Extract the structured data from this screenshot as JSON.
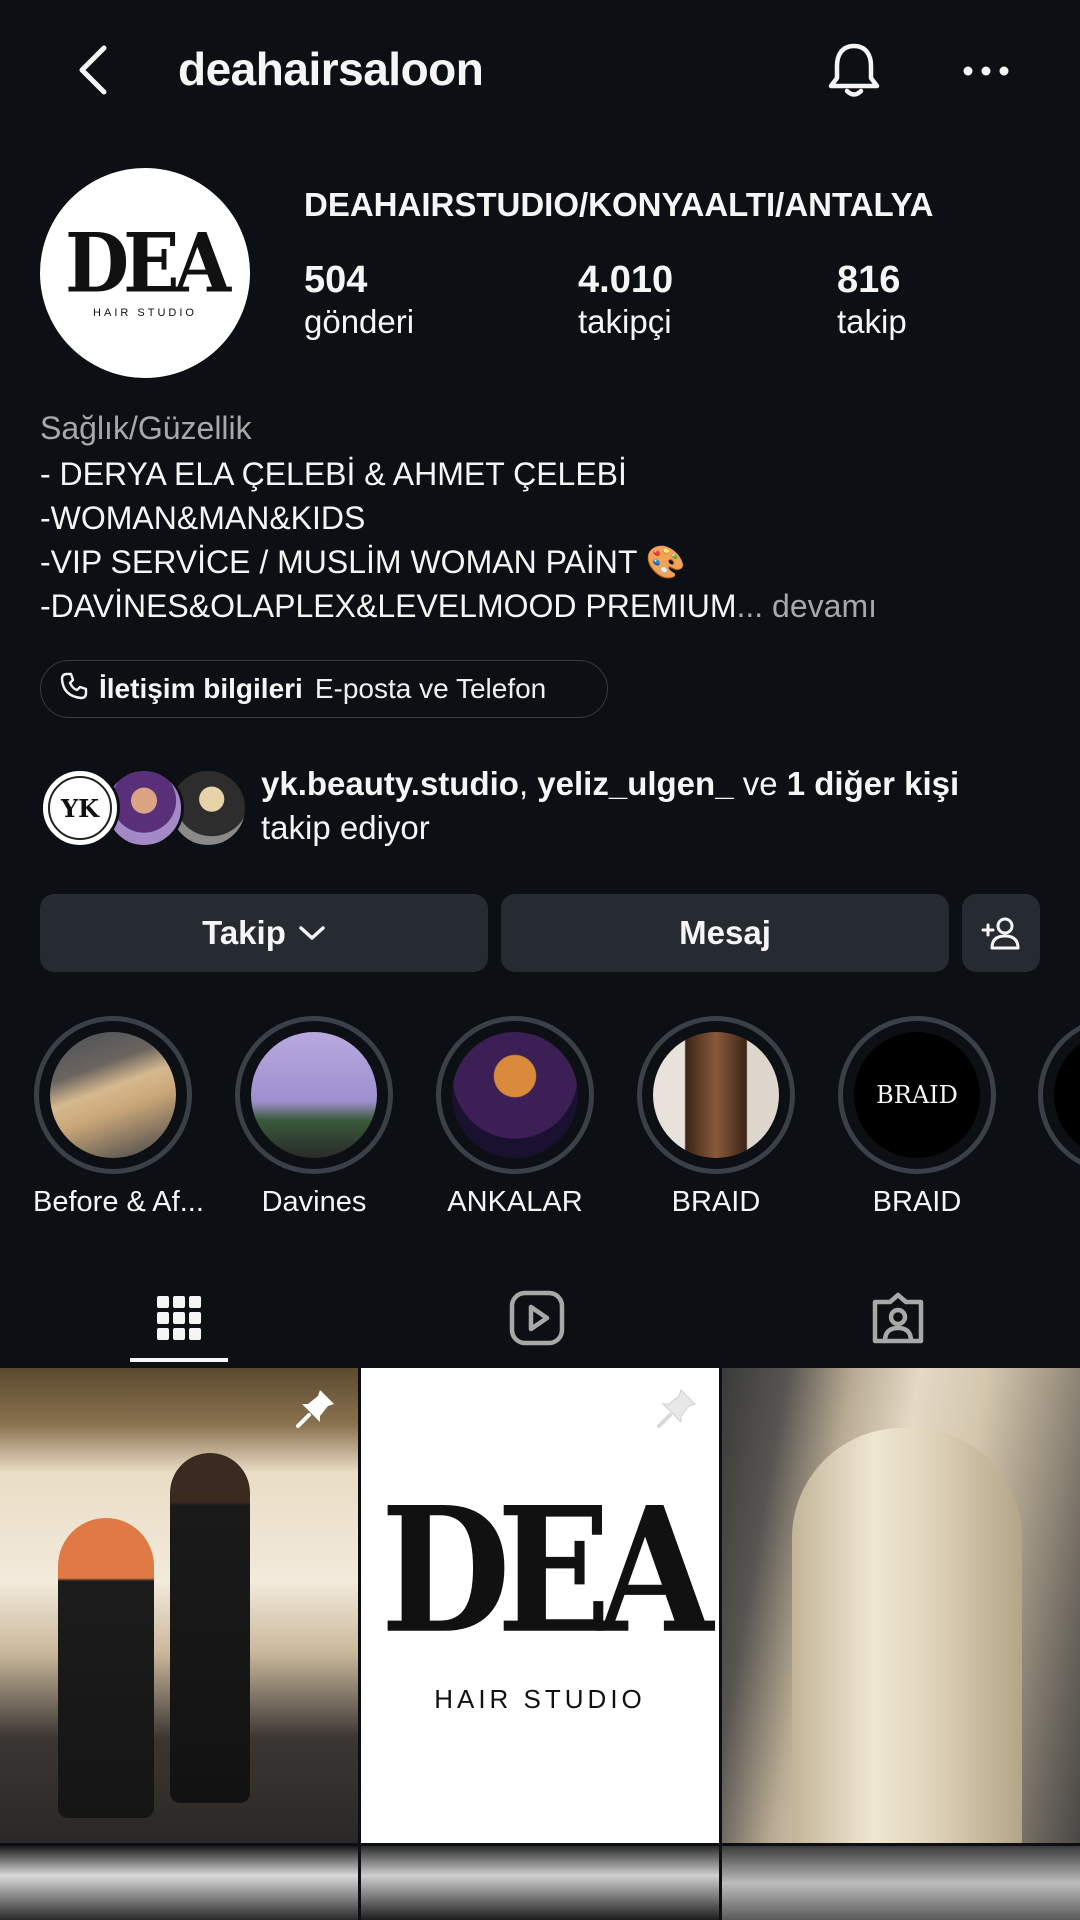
{
  "header": {
    "username": "deahairsaloon"
  },
  "profile": {
    "avatar_logo": "DEA",
    "avatar_sub": "HAIR STUDIO",
    "display_name": "DEAHAIRSTUDIO/KONYAALTI/ANTALYA",
    "stats": [
      {
        "value": "504",
        "label": "gönderi"
      },
      {
        "value": "4.010",
        "label": "takipçi"
      },
      {
        "value": "816",
        "label": "takip"
      }
    ],
    "category": "Sağlık/Güzellik",
    "bio": [
      "- DERYA ELA ÇELEBİ & AHMET ÇELEBİ",
      "-WOMAN&MAN&KIDS",
      "-VIP SERVİCE / MUSLİM WOMAN PAİNT 🎨",
      "-DAVİNES&OLAPLEX&LEVELMOOD PREMIUM"
    ],
    "more_link": "... devamı",
    "contact": {
      "bold": "İletişim bilgileri",
      "light": "E-posta ve Telefon"
    },
    "mutual": {
      "user1": "yk.beauty.studio",
      "sep": ",",
      "user2": "yeliz_ulgen_",
      "and": "ve",
      "others": "1 diğer kişi",
      "suffix": "takip ediyor",
      "first_avatar_text": "YK"
    }
  },
  "actions": {
    "follow": "Takip",
    "message": "Mesaj"
  },
  "highlights": [
    {
      "label": "Before & Af..."
    },
    {
      "label": "Davines"
    },
    {
      "label": "ANKALAR"
    },
    {
      "label": "BRAID"
    },
    {
      "label": "BRAID",
      "inner_text": "BRAID"
    }
  ],
  "grid": {
    "logo_text": "DEA",
    "logo_sub": "HAIR STUDIO"
  },
  "colors": {
    "background": "#0c1014",
    "button": "#262a31",
    "muted": "#a8a8a8",
    "ring": "#3b4048"
  }
}
